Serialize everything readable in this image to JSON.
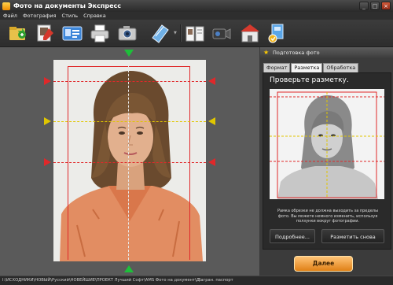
{
  "window": {
    "title": "Фото на документы Экспресс",
    "min": "_",
    "max": "□",
    "close": "×"
  },
  "menu": [
    "Файл",
    "Фотография",
    "Стиль",
    "Справка"
  ],
  "toolbar": {
    "icons": [
      "open-photo-icon",
      "edit-photo-icon",
      "id-card-icon",
      "print-icon",
      "camera-icon",
      "crop-icon",
      "book-icon",
      "video-camera-icon",
      "store-icon",
      "save-icon"
    ],
    "dropdown": "▼"
  },
  "panel": {
    "header": "Подготовка фото",
    "tabs": [
      "Формат",
      "Разметка",
      "Обработка"
    ],
    "active_tab": 1,
    "check_title": "Проверьте разметку.",
    "hint": "Рамка обрезки не должна выходить за пределы фото. Вы можете немного изменить, используя ползунки вокруг фотографии.",
    "more_button": "Подробнее...",
    "remark_button": "Разметить снова"
  },
  "next_button": "Далее",
  "status": {
    "path": "I:\\ИСХОДНИКИ\\НОВЫЙ\\Русский\\НОВЕЙШИЕ\\ПРОЕКТ Лучший Софт\\AMS Фото на документ\\Д...",
    "doc_type": "Загран. паспорт"
  },
  "colors": {
    "accent_red": "#e0282a",
    "guide_yellow": "#e0c600",
    "arrow_green": "#1dbf3a",
    "next_button": "#f0a040"
  }
}
